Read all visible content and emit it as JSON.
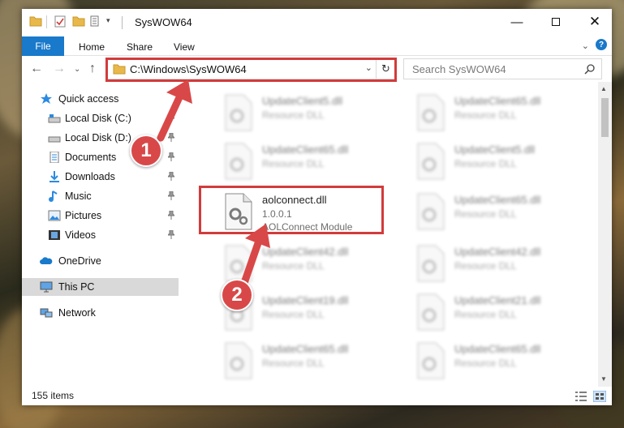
{
  "window": {
    "title": "SysWOW64"
  },
  "ribbon": {
    "tabs": [
      "File",
      "Home",
      "Share",
      "View"
    ],
    "help_label": "?"
  },
  "navbar": {
    "address": "C:\\Windows\\SysWOW64",
    "search_placeholder": "Search SysWOW64"
  },
  "sidebar": {
    "items": [
      {
        "label": "Quick access",
        "icon": "star-icon"
      },
      {
        "label": "Local Disk (C:)",
        "icon": "drive-icon"
      },
      {
        "label": "Local Disk (D:)",
        "icon": "drive-icon"
      },
      {
        "label": "Documents",
        "icon": "documents-icon"
      },
      {
        "label": "Downloads",
        "icon": "download-icon"
      },
      {
        "label": "Music",
        "icon": "music-icon"
      },
      {
        "label": "Pictures",
        "icon": "pictures-icon"
      },
      {
        "label": "Videos",
        "icon": "videos-icon"
      },
      {
        "label": "OneDrive",
        "icon": "cloud-icon"
      },
      {
        "label": "This PC",
        "icon": "computer-icon"
      },
      {
        "label": "Network",
        "icon": "network-icon"
      }
    ]
  },
  "files": {
    "left": [
      {
        "name": "UpdateClient5.dll",
        "line2": "Resource DLL",
        "line3": ""
      },
      {
        "name": "UpdateClient65.dll",
        "line2": "Resource DLL",
        "line3": ""
      },
      {
        "name": "aolconnect.dll",
        "line2": "1.0.0.1",
        "line3": "AOLConnect Module"
      },
      {
        "name": "UpdateClient42.dll",
        "line2": "Resource DLL",
        "line3": ""
      },
      {
        "name": "UpdateClient19.dll",
        "line2": "Resource DLL",
        "line3": ""
      },
      {
        "name": "UpdateClient65.dll",
        "line2": "Resource DLL",
        "line3": ""
      }
    ],
    "right": [
      {
        "name": "UpdateClient65.dll",
        "line2": "Resource DLL",
        "line3": ""
      },
      {
        "name": "UpdateClient5.dll",
        "line2": "Resource DLL",
        "line3": ""
      },
      {
        "name": "UpdateClient65.dll",
        "line2": "Resource DLL",
        "line3": ""
      },
      {
        "name": "UpdateClient42.dll",
        "line2": "Resource DLL",
        "line3": ""
      },
      {
        "name": "UpdateClient21.dll",
        "line2": "Resource DLL",
        "line3": ""
      },
      {
        "name": "UpdateClient65.dll",
        "line2": "Resource DLL",
        "line3": ""
      }
    ]
  },
  "status": {
    "item_count": "155 items"
  },
  "callouts": [
    "1",
    "2"
  ],
  "colors": {
    "accent": "#1979ca",
    "highlight": "#d23b3b",
    "callout": "#d94848"
  }
}
